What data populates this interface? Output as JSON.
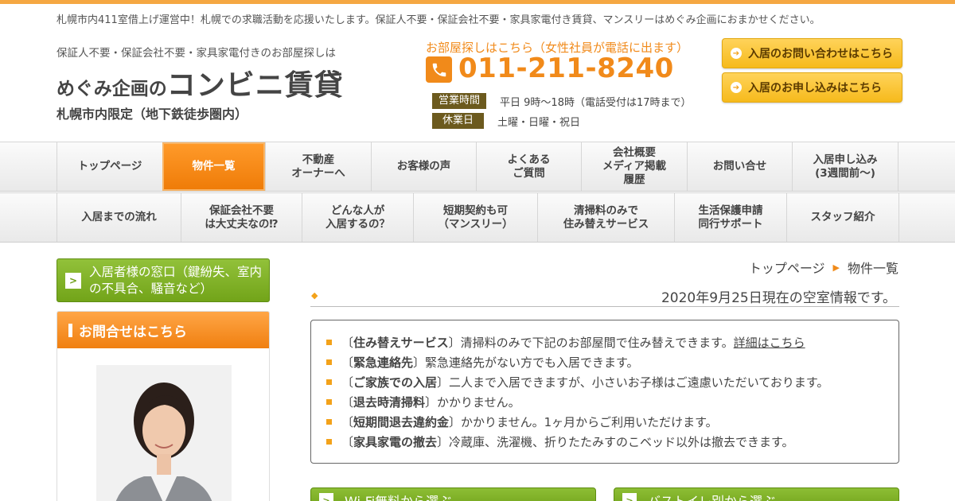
{
  "header": {
    "tagline": "札幌市内411室借上げ運営中！札幌での求職活動を応援いたします。保証人不要・保証会社不要・家具家電付き賃貸、マンスリーはめぐみ企画におまかせください。",
    "logo_sub": "保証人不要・保証会社不要・家具家電付きのお部屋探しは",
    "logo_small": "めぐみ企画の",
    "logo_big": "コンビニ賃貸",
    "logo_area": "札幌市内限定（地下鉄徒歩圏内）",
    "phone_caption": "お部屋探しはこちら（女性社員が電話に出ます）",
    "phone_number": "011-211-8240",
    "hours_label": "営業時間",
    "hours_value": "平日 9時～18時（電話受付は17時まで）",
    "holiday_label": "休業日",
    "holiday_value": "土曜・日曜・祝日",
    "cta_contact": "入居のお問い合わせはこちら",
    "cta_apply": "入居のお申し込みはこちら"
  },
  "nav_main": [
    "トップページ",
    "物件一覧",
    "不動産\nオーナーへ",
    "お客様の声",
    "よくある\nご質問",
    "会社概要\nメディア掲載\n履歴",
    "お問い合せ",
    "入居申し込み\n(3週間前～)"
  ],
  "nav_sub": [
    "入居までの流れ",
    "保証会社不要\nは大丈夫なの⁉",
    "どんな人が\n入居するの？",
    "短期契約も可\n（マンスリー）",
    "清掃料のみで\n住み替えサービス",
    "生活保護申請\n同行サポート",
    "スタッフ紹介"
  ],
  "sidebar": {
    "resident_window": "入居者様の窓口（鍵紛失、室内の不具合、騒音など）",
    "contact_title": "お問合せはこちら"
  },
  "breadcrumb": {
    "home": "トップページ",
    "current": "物件一覧"
  },
  "main": {
    "date_notice": "2020年9月25日現在の空室情報です。",
    "info_items": [
      {
        "title": "住み替えサービス",
        "text": "清掃料のみで下記のお部屋間で住み替えできます。",
        "link": "詳細はこちら"
      },
      {
        "title": "緊急連絡先",
        "text": "緊急連絡先がない方でも入居できます。",
        "link": ""
      },
      {
        "title": "ご家族での入居",
        "text": "二人まで入居できますが、小さいお子様はご遠慮いただいております。",
        "link": ""
      },
      {
        "title": "退去時清掃料",
        "text": "かかりません。",
        "link": ""
      },
      {
        "title": "短期間退去違約金",
        "text": "かかりません。1ヶ月からご利用いただけます。",
        "link": ""
      },
      {
        "title": "家具家電の撤去",
        "text": "冷蔵庫、洗濯機、折りたたみすのこベッド以外は撤去できます。",
        "link": ""
      }
    ],
    "wifi_button": "Wi-Fi無料から選ぶ",
    "bath_button": "バストイレ別から選ぶ"
  },
  "colors": {
    "accent_orange": "#f18a1a",
    "green": "#7cae22",
    "hours_badge": "#6c5a1e"
  },
  "icons": {
    "phone": "phone-icon",
    "arrow": "arrow-right-icon"
  }
}
